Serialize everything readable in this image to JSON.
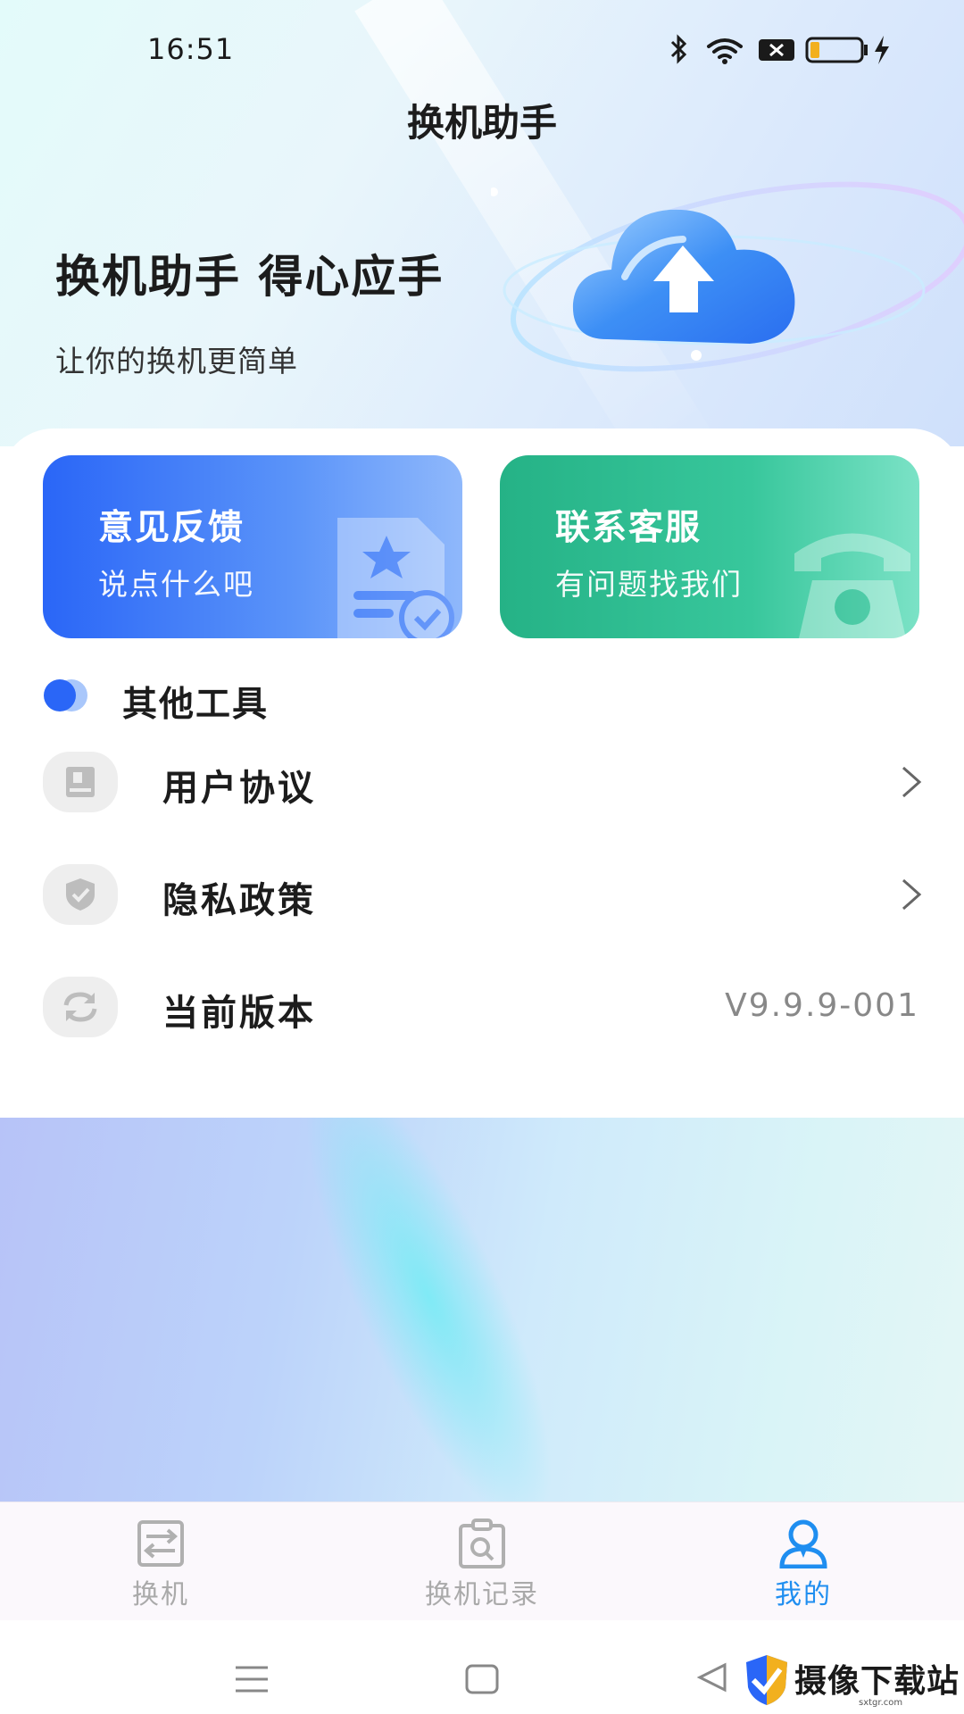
{
  "status_bar": {
    "time": "16:51"
  },
  "header": {
    "title": "换机助手"
  },
  "hero": {
    "headline": "换机助手 得心应手",
    "subtitle": "让你的换机更简单"
  },
  "cards": {
    "feedback": {
      "title": "意见反馈",
      "subtitle": "说点什么吧"
    },
    "service": {
      "title": "联系客服",
      "subtitle": "有问题找我们"
    }
  },
  "tools_section": {
    "title": "其他工具",
    "rows": [
      {
        "label": "用户协议",
        "icon": "document-icon",
        "trailing": "chevron"
      },
      {
        "label": "隐私政策",
        "icon": "shield-icon",
        "trailing": "chevron"
      },
      {
        "label": "当前版本",
        "icon": "refresh-icon",
        "value": "V9.9.9-001"
      }
    ]
  },
  "bottom_nav": {
    "items": [
      {
        "label": "换机",
        "icon": "transfer-icon",
        "active": false
      },
      {
        "label": "换机记录",
        "icon": "clipboard-icon",
        "active": false
      },
      {
        "label": "我的",
        "icon": "user-icon",
        "active": true
      }
    ]
  },
  "watermark": {
    "text": "摄像下载站",
    "url": "sxtgr.com"
  },
  "colors": {
    "feedback_card": "#2a66f7",
    "service_card": "#25b286",
    "active_tab": "#1f8ef0",
    "inactive_tab": "#aaaaaa"
  }
}
